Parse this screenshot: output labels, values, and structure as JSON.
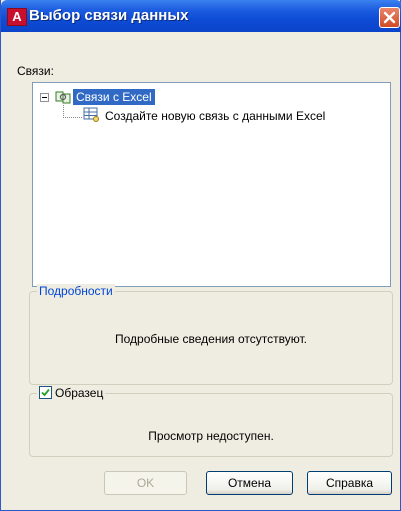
{
  "window": {
    "title": "Выбор связи данных",
    "app_icon_letter": "A"
  },
  "links_label": "Связи:",
  "tree": {
    "root_label": "Связи с Excel",
    "child_label": "Создайте новую связь с данными Excel"
  },
  "details": {
    "legend": "Подробности",
    "text": "Подробные сведения отсутствуют."
  },
  "sample": {
    "legend": "Образец",
    "checked": true,
    "text": "Просмотр недоступен."
  },
  "buttons": {
    "ok": "OK",
    "cancel": "Отмена",
    "help": "Справка"
  }
}
